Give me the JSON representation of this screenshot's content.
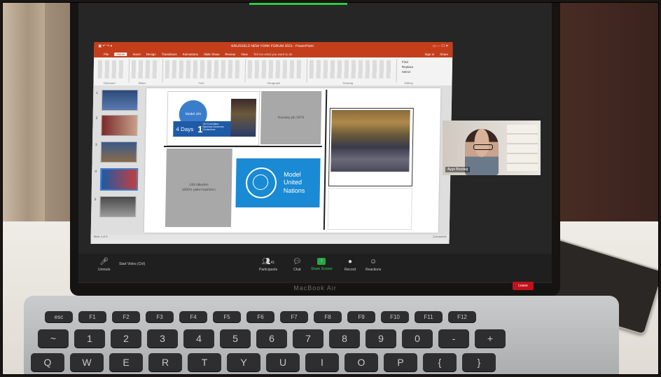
{
  "ppt": {
    "window_title": "BRUSSELS NEW YORK FORUM 2021 - PowerPoint",
    "menu": [
      "File",
      "Home",
      "Insert",
      "Design",
      "Transitions",
      "Animations",
      "Slide Show",
      "Review",
      "View"
    ],
    "tell_me": "Tell me what you want to do",
    "signin": "Sign in",
    "share": "Share",
    "ribbon_groups": [
      "Clipboard",
      "Slides",
      "Font",
      "Paragraph",
      "Drawing",
      "Editing"
    ],
    "ribbon_editing": [
      "Find",
      "Replace",
      "Select"
    ],
    "thumb_numbers": [
      "1",
      "2",
      "3",
      "4",
      "5"
    ],
    "status_left": "Slide 4 of 5",
    "status_right": "Comments"
  },
  "slide": {
    "p1_badge": "Model UN",
    "p1_days": "4 Days",
    "p1_num": "1",
    "p1_small": "UN Committee Opening Ceremony Conference",
    "p2_text": "Kuruluş yılı 1975",
    "p3_text": "193 ülkeden\n1000'e yakın katılımcı",
    "p4_text": [
      "Model",
      "United",
      "Nations"
    ]
  },
  "video": {
    "name": "Ayşe Bozdağ"
  },
  "zoom": {
    "mute": "Unmute",
    "start_video": "Start Video (Ctrl)",
    "participants": "Participants",
    "participants_count": "41",
    "chat": "Chat",
    "share_screen": "Share Screen",
    "record": "Record",
    "reactions": "Reactions",
    "leave": "Leave"
  },
  "laptop": {
    "brand": "MacBook Air"
  },
  "keyboard": {
    "row1": [
      "esc",
      "F1",
      "F2",
      "F3",
      "F4",
      "F5",
      "F6",
      "F7",
      "F8",
      "F9",
      "F10",
      "F11",
      "F12"
    ],
    "row2": [
      "~",
      "1",
      "2",
      "3",
      "4",
      "5",
      "6",
      "7",
      "8",
      "9",
      "0",
      "-",
      "+"
    ],
    "row3": [
      "Q",
      "W",
      "E",
      "R",
      "T",
      "Y",
      "U",
      "I",
      "O",
      "P",
      "{",
      "}"
    ]
  }
}
